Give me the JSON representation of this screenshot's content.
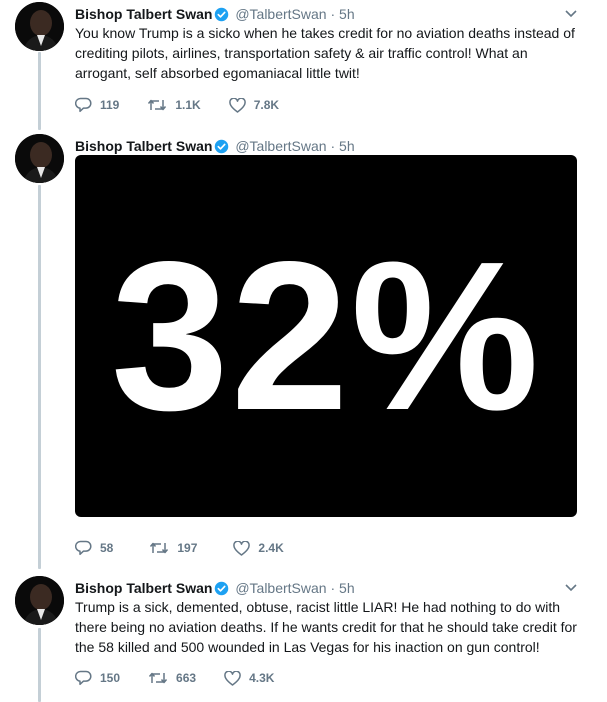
{
  "tweets": [
    {
      "name": "Bishop Talbert Swan",
      "handle": "@TalbertSwan",
      "separator": "·",
      "time": "5h",
      "text": "You know Trump is a sicko when he takes credit for no aviation deaths instead of crediting pilots, airlines, transportation safety & air traffic control! What an arrogant, self absorbed egomaniacal little twit!",
      "replies": "119",
      "retweets": "1.1K",
      "likes": "7.8K"
    },
    {
      "name": "Bishop Talbert Swan",
      "handle": "@TalbertSwan",
      "separator": "·",
      "time": "5h",
      "media_text": "32%",
      "replies": "58",
      "retweets": "197",
      "likes": "2.4K"
    },
    {
      "name": "Bishop Talbert Swan",
      "handle": "@TalbertSwan",
      "separator": "·",
      "time": "5h",
      "text": "Trump is a sick, demented, obtuse, racist little LIAR! He had nothing to do with there being no aviation deaths. If he wants credit for that he should take credit for the 58 killed and 500 wounded in Las Vegas for his inaction on gun control!",
      "replies": "150",
      "retweets": "663",
      "likes": "4.3K"
    }
  ],
  "icons": {
    "reply": "reply-icon",
    "retweet": "retweet-icon",
    "like": "heart-icon",
    "verified": "verified-badge-icon",
    "more": "chevron-down-icon"
  },
  "colors": {
    "text": "#14171a",
    "muted": "#657786",
    "verified": "#1da1f2",
    "thread_line": "#c4cfd6",
    "media_bg": "#000000"
  }
}
